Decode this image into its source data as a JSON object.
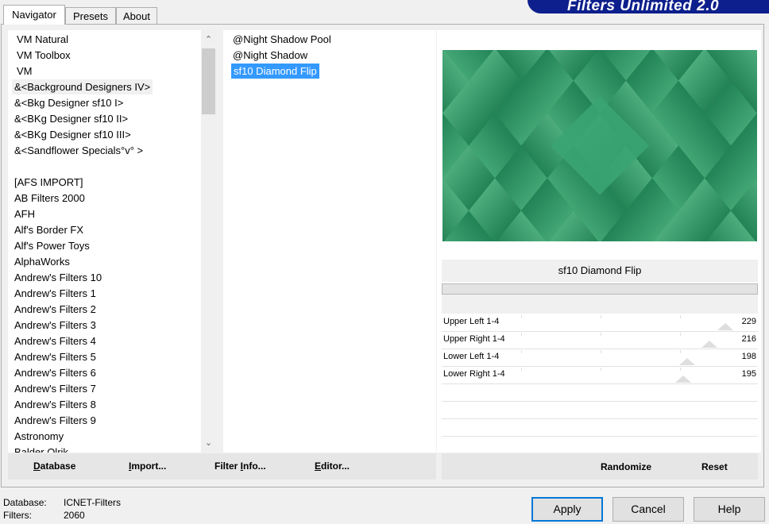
{
  "tabs": [
    "Navigator",
    "Presets",
    "About"
  ],
  "app_title": "Filters Unlimited 2.0",
  "categories": [
    "VM Natural",
    "VM Toolbox",
    "VM",
    "&<Background Designers IV>",
    "&<Bkg Designer sf10 I>",
    "&<BKg Designer sf10 II>",
    "&<BKg Designer sf10 III>",
    "&<Sandflower Specials°v° >",
    "",
    "[AFS IMPORT]",
    "AB Filters 2000",
    "AFH",
    "Alf's Border FX",
    "Alf's Power Toys",
    "AlphaWorks",
    "Andrew's Filters 10",
    "Andrew's Filters 1",
    "Andrew's Filters 2",
    "Andrew's Filters 3",
    "Andrew's Filters 4",
    "Andrew's Filters 5",
    "Andrew's Filters 6",
    "Andrew's Filters 7",
    "Andrew's Filters 8",
    "Andrew's Filters 9",
    "Astronomy",
    "Balder Olrik"
  ],
  "selected_category": "&<Background Designers IV>",
  "filters": [
    "@Night Shadow Pool",
    "@Night Shadow",
    "sf10 Diamond Flip"
  ],
  "selected_filter": "sf10 Diamond Flip",
  "filter_name": "sf10 Diamond Flip",
  "params": [
    {
      "label": "Upper Left 1-4",
      "value": 229
    },
    {
      "label": "Upper Right 1-4",
      "value": 216
    },
    {
      "label": "Lower Left 1-4",
      "value": 198
    },
    {
      "label": "Lower Right 1-4",
      "value": 195
    }
  ],
  "left_buttons": [
    {
      "key": "database",
      "mnemonic": "D",
      "rest": "atabase"
    },
    {
      "key": "import",
      "mnemonic": "I",
      "rest": "mport..."
    },
    {
      "key": "filter-info",
      "pre": "Filter ",
      "mnemonic": "I",
      "rest": "nfo..."
    },
    {
      "key": "editor",
      "mnemonic": "E",
      "rest": "ditor..."
    }
  ],
  "randomize_label": "Randomize",
  "reset_label": "Reset",
  "status": {
    "database_label": "Database:",
    "database_value": "ICNET-Filters",
    "filters_label": "Filters:",
    "filters_value": "2060"
  },
  "apply_label": "Apply",
  "cancel_label": "Cancel",
  "help_label": "Help",
  "colors": {
    "accent": "#0d1f8c",
    "selection": "#3399ff",
    "preview_dark": "#0d6b40",
    "preview_light": "#6fcc9b"
  }
}
